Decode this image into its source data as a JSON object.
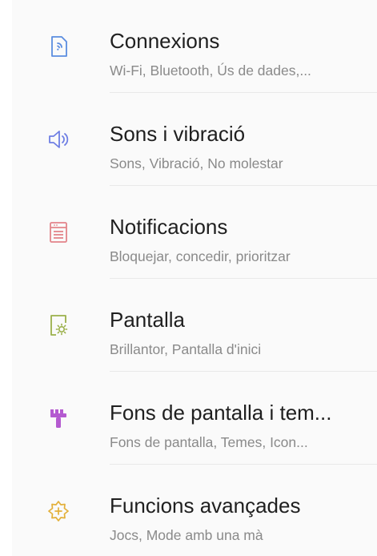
{
  "settings": {
    "items": [
      {
        "icon": "connections-icon",
        "title": "Connexions",
        "subtitle": "Wi-Fi, Bluetooth, Ús de dades,...",
        "color": "#5b8de0"
      },
      {
        "icon": "sound-icon",
        "title": "Sons i vibració",
        "subtitle": "Sons, Vibració, No molestar",
        "color": "#6f7fe4"
      },
      {
        "icon": "notifications-icon",
        "title": "Notificacions",
        "subtitle": "Bloquejar, concedir, prioritzar",
        "color": "#e3848a"
      },
      {
        "icon": "display-icon",
        "title": "Pantalla",
        "subtitle": "Brillantor, Pantalla d'inici",
        "color": "#9bb04a"
      },
      {
        "icon": "wallpaper-themes-icon",
        "title": "Fons de pantalla i tem...",
        "subtitle": "Fons de pantalla, Temes, Icon...",
        "color": "#b45ad0"
      },
      {
        "icon": "advanced-features-icon",
        "title": "Funcions avançades",
        "subtitle": "Jocs, Mode amb una mà",
        "color": "#e3b03a"
      }
    ]
  }
}
